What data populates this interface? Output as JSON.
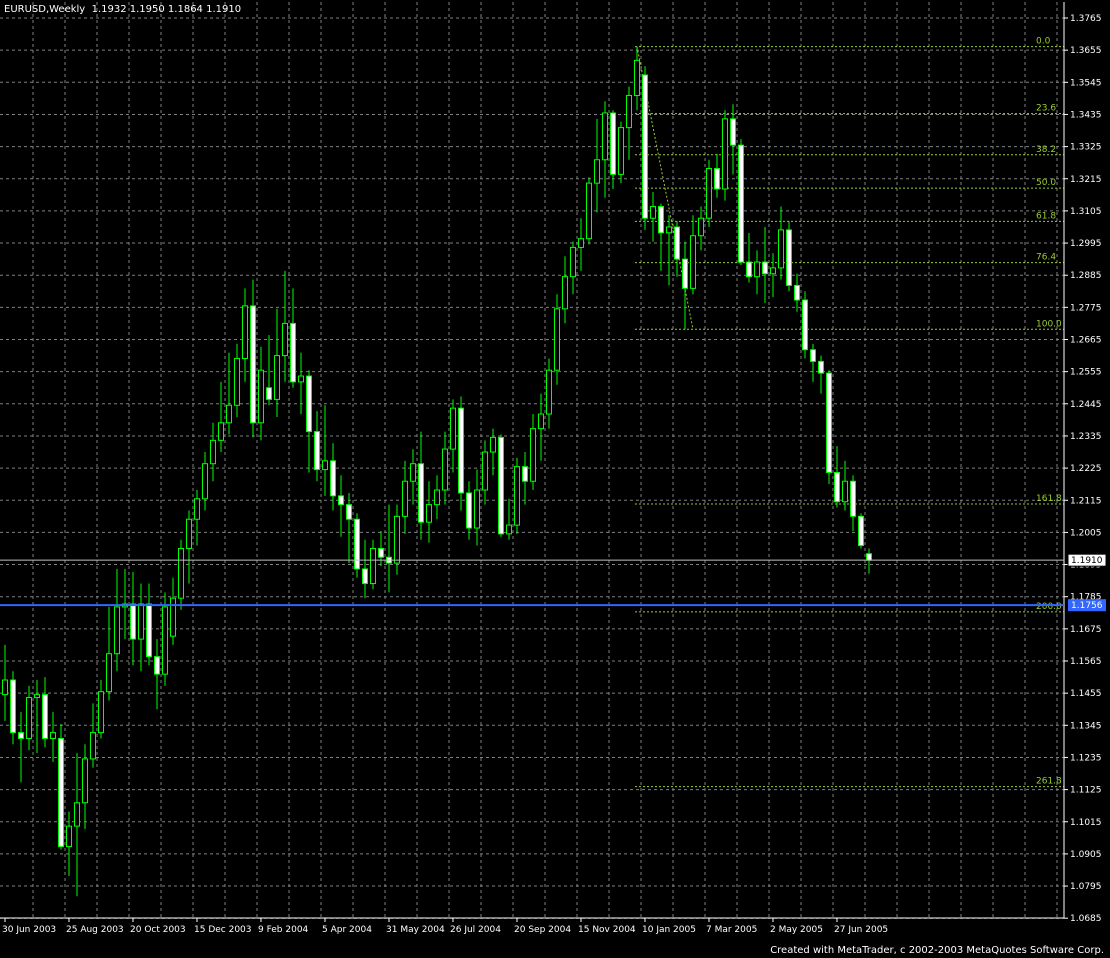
{
  "header": {
    "symbol": "EURUSD,Weekly",
    "ohlc": "1.1932 1.1950 1.1864 1.1910"
  },
  "footer": {
    "credit": "Created with MetaTrader, c 2002-2003 MetaQuotes Software Corp."
  },
  "colors": {
    "background": "#000000",
    "grid": "#808080",
    "axis": "#ffffff",
    "candle_up_body": "#000000",
    "candle_down_body": "#ffffff",
    "candle_outline": "#00ff00",
    "fib": "#9acd32",
    "hline": "#3366ff",
    "price_box": "#ffffff",
    "hline_box": "#3366ff"
  },
  "chart_data": {
    "type": "candlestick",
    "symbol": "EURUSD",
    "timeframe": "Weekly",
    "ylim": [
      1.0685,
      1.3765
    ],
    "y_ticks": [
      "1.3765",
      "1.3655",
      "1.3545",
      "1.3435",
      "1.3325",
      "1.3215",
      "1.3105",
      "1.2995",
      "1.2885",
      "1.2775",
      "1.2665",
      "1.2555",
      "1.2445",
      "1.2335",
      "1.2225",
      "1.2115",
      "1.2005",
      "1.1895",
      "1.1785",
      "1.1675",
      "1.1565",
      "1.1455",
      "1.1345",
      "1.1235",
      "1.1125",
      "1.1015",
      "1.0905",
      "1.0795",
      "1.0685"
    ],
    "x_tick_labels": [
      "30 Jun 2003",
      "25 Aug 2003",
      "20 Oct 2003",
      "15 Dec 2003",
      "9 Feb 2004",
      "5 Apr 2004",
      "31 May 2004",
      "26 Jul 2004",
      "20 Sep 2004",
      "15 Nov 2004",
      "10 Jan 2005",
      "7 Mar 2005",
      "2 May 2005",
      "27 Jun 2005"
    ],
    "grid": true,
    "current_price": "1.1910",
    "horizontal_line": {
      "price": 1.1756,
      "label": "1.1756"
    },
    "fibonacci": {
      "levels": [
        {
          "label": "0.0",
          "price": 1.3667
        },
        {
          "label": "23.6",
          "price": 1.3438
        },
        {
          "label": "38.2",
          "price": 1.3297
        },
        {
          "label": "50.0",
          "price": 1.3183
        },
        {
          "label": "61.8",
          "price": 1.3069
        },
        {
          "label": "76.4",
          "price": 1.2928
        },
        {
          "label": "100.0",
          "price": 1.27
        },
        {
          "label": "161.8",
          "price": 1.2102
        },
        {
          "label": "200.0",
          "price": 1.1733
        },
        {
          "label": "261.8",
          "price": 1.1135
        }
      ],
      "trend_from": {
        "bar": 79,
        "price": 1.3667
      },
      "trend_to": {
        "bar": 86,
        "price": 1.27
      }
    },
    "candles": [
      [
        1.145,
        1.162,
        1.136,
        1.15
      ],
      [
        1.15,
        1.153,
        1.128,
        1.132
      ],
      [
        1.132,
        1.139,
        1.115,
        1.13
      ],
      [
        1.13,
        1.148,
        1.126,
        1.144
      ],
      [
        1.144,
        1.15,
        1.125,
        1.145
      ],
      [
        1.145,
        1.151,
        1.127,
        1.13
      ],
      [
        1.13,
        1.139,
        1.122,
        1.132
      ],
      [
        1.13,
        1.135,
        1.092,
        1.093
      ],
      [
        1.093,
        1.105,
        1.083,
        1.1
      ],
      [
        1.1,
        1.125,
        1.076,
        1.108
      ],
      [
        1.108,
        1.128,
        1.099,
        1.123
      ],
      [
        1.123,
        1.142,
        1.12,
        1.132
      ],
      [
        1.132,
        1.15,
        1.13,
        1.146
      ],
      [
        1.146,
        1.175,
        1.143,
        1.159
      ],
      [
        1.159,
        1.188,
        1.153,
        1.175
      ],
      [
        1.175,
        1.188,
        1.164,
        1.176
      ],
      [
        1.176,
        1.187,
        1.155,
        1.164
      ],
      [
        1.164,
        1.183,
        1.153,
        1.176
      ],
      [
        1.176,
        1.183,
        1.155,
        1.158
      ],
      [
        1.158,
        1.164,
        1.14,
        1.152
      ],
      [
        1.152,
        1.18,
        1.148,
        1.175
      ],
      [
        1.165,
        1.185,
        1.162,
        1.178
      ],
      [
        1.178,
        1.198,
        1.174,
        1.195
      ],
      [
        1.195,
        1.208,
        1.183,
        1.205
      ],
      [
        1.205,
        1.215,
        1.196,
        1.212
      ],
      [
        1.212,
        1.228,
        1.208,
        1.224
      ],
      [
        1.224,
        1.238,
        1.218,
        1.232
      ],
      [
        1.232,
        1.252,
        1.228,
        1.238
      ],
      [
        1.238,
        1.262,
        1.234,
        1.244
      ],
      [
        1.244,
        1.265,
        1.24,
        1.26
      ],
      [
        1.26,
        1.284,
        1.252,
        1.278
      ],
      [
        1.278,
        1.287,
        1.233,
        1.238
      ],
      [
        1.238,
        1.264,
        1.232,
        1.256
      ],
      [
        1.25,
        1.268,
        1.244,
        1.246
      ],
      [
        1.246,
        1.277,
        1.24,
        1.261
      ],
      [
        1.261,
        1.29,
        1.252,
        1.272
      ],
      [
        1.272,
        1.284,
        1.25,
        1.252
      ],
      [
        1.252,
        1.262,
        1.241,
        1.254
      ],
      [
        1.254,
        1.256,
        1.221,
        1.235
      ],
      [
        1.235,
        1.242,
        1.218,
        1.222
      ],
      [
        1.222,
        1.244,
        1.213,
        1.225
      ],
      [
        1.225,
        1.231,
        1.208,
        1.213
      ],
      [
        1.213,
        1.22,
        1.199,
        1.21
      ],
      [
        1.21,
        1.214,
        1.19,
        1.205
      ],
      [
        1.205,
        1.207,
        1.185,
        1.188
      ],
      [
        1.188,
        1.198,
        1.178,
        1.183
      ],
      [
        1.183,
        1.198,
        1.181,
        1.195
      ],
      [
        1.195,
        1.201,
        1.189,
        1.192
      ],
      [
        1.192,
        1.21,
        1.18,
        1.19
      ],
      [
        1.19,
        1.21,
        1.186,
        1.206
      ],
      [
        1.206,
        1.225,
        1.2,
        1.218
      ],
      [
        1.218,
        1.229,
        1.21,
        1.224
      ],
      [
        1.224,
        1.235,
        1.198,
        1.204
      ],
      [
        1.204,
        1.218,
        1.197,
        1.21
      ],
      [
        1.21,
        1.22,
        1.205,
        1.215
      ],
      [
        1.215,
        1.235,
        1.21,
        1.229
      ],
      [
        1.229,
        1.246,
        1.221,
        1.243
      ],
      [
        1.243,
        1.247,
        1.208,
        1.214
      ],
      [
        1.214,
        1.218,
        1.198,
        1.202
      ],
      [
        1.202,
        1.222,
        1.196,
        1.215
      ],
      [
        1.215,
        1.232,
        1.21,
        1.228
      ],
      [
        1.228,
        1.236,
        1.22,
        1.233
      ],
      [
        1.233,
        1.234,
        1.199,
        1.2
      ],
      [
        1.2,
        1.212,
        1.198,
        1.203
      ],
      [
        1.203,
        1.226,
        1.2,
        1.223
      ],
      [
        1.223,
        1.228,
        1.21,
        1.218
      ],
      [
        1.218,
        1.241,
        1.215,
        1.236
      ],
      [
        1.236,
        1.248,
        1.225,
        1.241
      ],
      [
        1.241,
        1.26,
        1.236,
        1.256
      ],
      [
        1.256,
        1.282,
        1.251,
        1.277
      ],
      [
        1.277,
        1.295,
        1.272,
        1.288
      ],
      [
        1.288,
        1.3,
        1.282,
        1.298
      ],
      [
        1.298,
        1.308,
        1.29,
        1.301
      ],
      [
        1.301,
        1.322,
        1.299,
        1.32
      ],
      [
        1.32,
        1.342,
        1.31,
        1.328
      ],
      [
        1.328,
        1.348,
        1.315,
        1.344
      ],
      [
        1.344,
        1.345,
        1.318,
        1.323
      ],
      [
        1.323,
        1.341,
        1.32,
        1.339
      ],
      [
        1.339,
        1.353,
        1.328,
        1.35
      ],
      [
        1.35,
        1.3667,
        1.345,
        1.362
      ],
      [
        1.357,
        1.36,
        1.304,
        1.308
      ],
      [
        1.308,
        1.317,
        1.3,
        1.312
      ],
      [
        1.312,
        1.313,
        1.29,
        1.303
      ],
      [
        1.303,
        1.309,
        1.285,
        1.305
      ],
      [
        1.305,
        1.307,
        1.288,
        1.294
      ],
      [
        1.294,
        1.3,
        1.27,
        1.284
      ],
      [
        1.284,
        1.309,
        1.282,
        1.302
      ],
      [
        1.302,
        1.312,
        1.297,
        1.308
      ],
      [
        1.308,
        1.328,
        1.305,
        1.325
      ],
      [
        1.325,
        1.33,
        1.315,
        1.318
      ],
      [
        1.318,
        1.345,
        1.314,
        1.342
      ],
      [
        1.342,
        1.347,
        1.323,
        1.333
      ],
      [
        1.333,
        1.335,
        1.292,
        1.293
      ],
      [
        1.293,
        1.303,
        1.286,
        1.288
      ],
      [
        1.288,
        1.297,
        1.282,
        1.293
      ],
      [
        1.293,
        1.305,
        1.279,
        1.289
      ],
      [
        1.289,
        1.296,
        1.281,
        1.291
      ],
      [
        1.291,
        1.312,
        1.287,
        1.304
      ],
      [
        1.304,
        1.307,
        1.283,
        1.285
      ],
      [
        1.285,
        1.289,
        1.276,
        1.28
      ],
      [
        1.28,
        1.283,
        1.26,
        1.263
      ],
      [
        1.263,
        1.265,
        1.252,
        1.259
      ],
      [
        1.259,
        1.261,
        1.248,
        1.255
      ],
      [
        1.255,
        1.256,
        1.217,
        1.221
      ],
      [
        1.221,
        1.23,
        1.209,
        1.211
      ],
      [
        1.211,
        1.225,
        1.208,
        1.218
      ],
      [
        1.218,
        1.22,
        1.201,
        1.206
      ],
      [
        1.206,
        1.207,
        1.195,
        1.196
      ],
      [
        1.1932,
        1.195,
        1.1864,
        1.191
      ]
    ]
  }
}
